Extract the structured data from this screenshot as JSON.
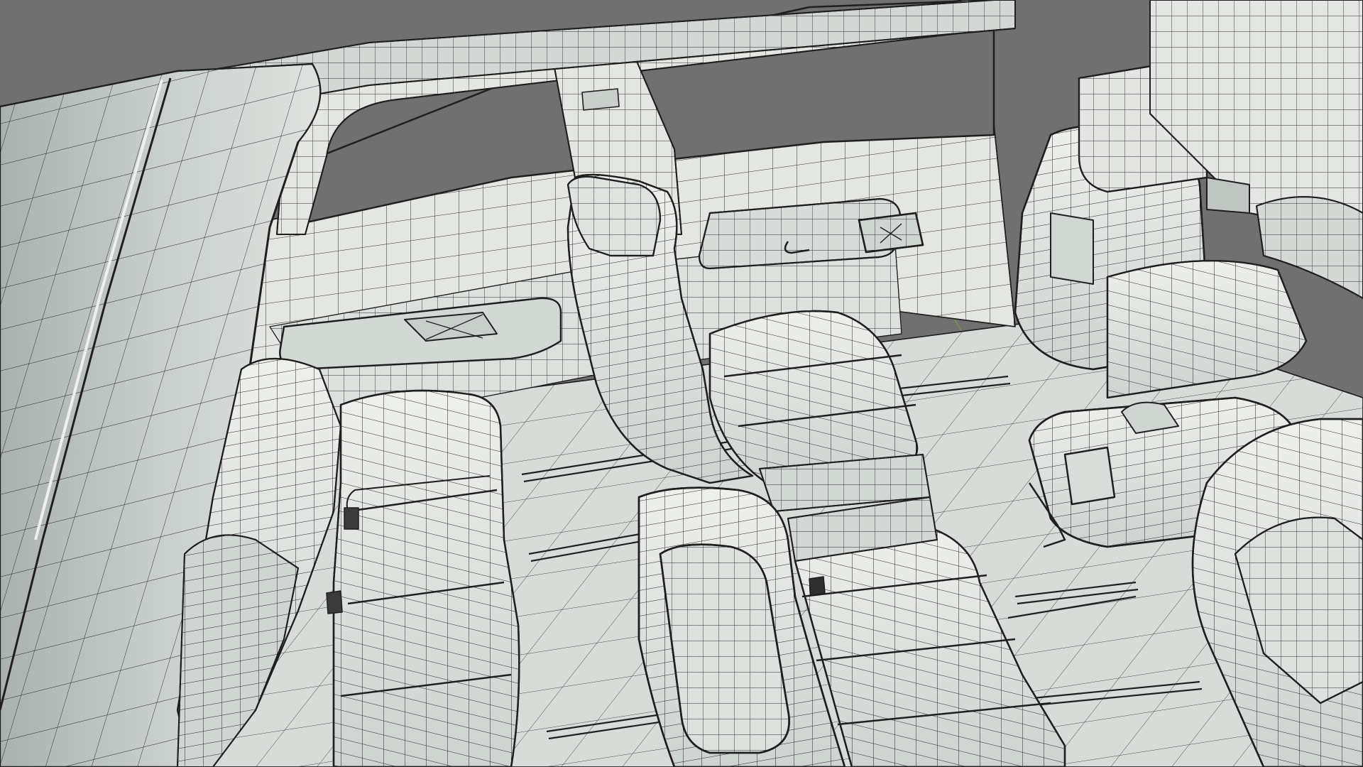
{
  "viewport": {
    "mode": "wireframe-on-shaded",
    "background_color": "#707070",
    "surface_color": "#e4e6e2",
    "surface_shadow_color": "#c4cac6",
    "wire_color": "#1f1f1f",
    "axis_x_color": "#c04040",
    "axis_y_color": "#6fa03a"
  },
  "scene": {
    "objects": [
      {
        "id": "pillar-left",
        "name": "b-pillar-left-icon"
      },
      {
        "id": "roof-rail",
        "name": "roof-rail-icon"
      },
      {
        "id": "c-pillar",
        "name": "c-pillar-icon"
      },
      {
        "id": "interior-wall",
        "name": "interior-side-wall-icon"
      },
      {
        "id": "window-frame",
        "name": "window-frame-icon"
      },
      {
        "id": "door-handle",
        "name": "door-handle-icon"
      },
      {
        "id": "speaker-front",
        "name": "speaker-front-icon"
      },
      {
        "id": "speaker-rear",
        "name": "speaker-rear-icon"
      },
      {
        "id": "floor",
        "name": "cabin-floor-icon"
      },
      {
        "id": "seat-rail-1",
        "name": "seat-rail-icon"
      },
      {
        "id": "bench-seat",
        "name": "rear-bench-seat-icon"
      },
      {
        "id": "captain-seat-middle",
        "name": "captain-seat-middle-icon"
      },
      {
        "id": "captain-seat-front",
        "name": "captain-seat-front-icon"
      },
      {
        "id": "driver-seat",
        "name": "driver-seat-icon"
      },
      {
        "id": "center-console",
        "name": "center-console-icon"
      },
      {
        "id": "passenger-seat-corner",
        "name": "passenger-seat-corner-icon"
      }
    ]
  }
}
